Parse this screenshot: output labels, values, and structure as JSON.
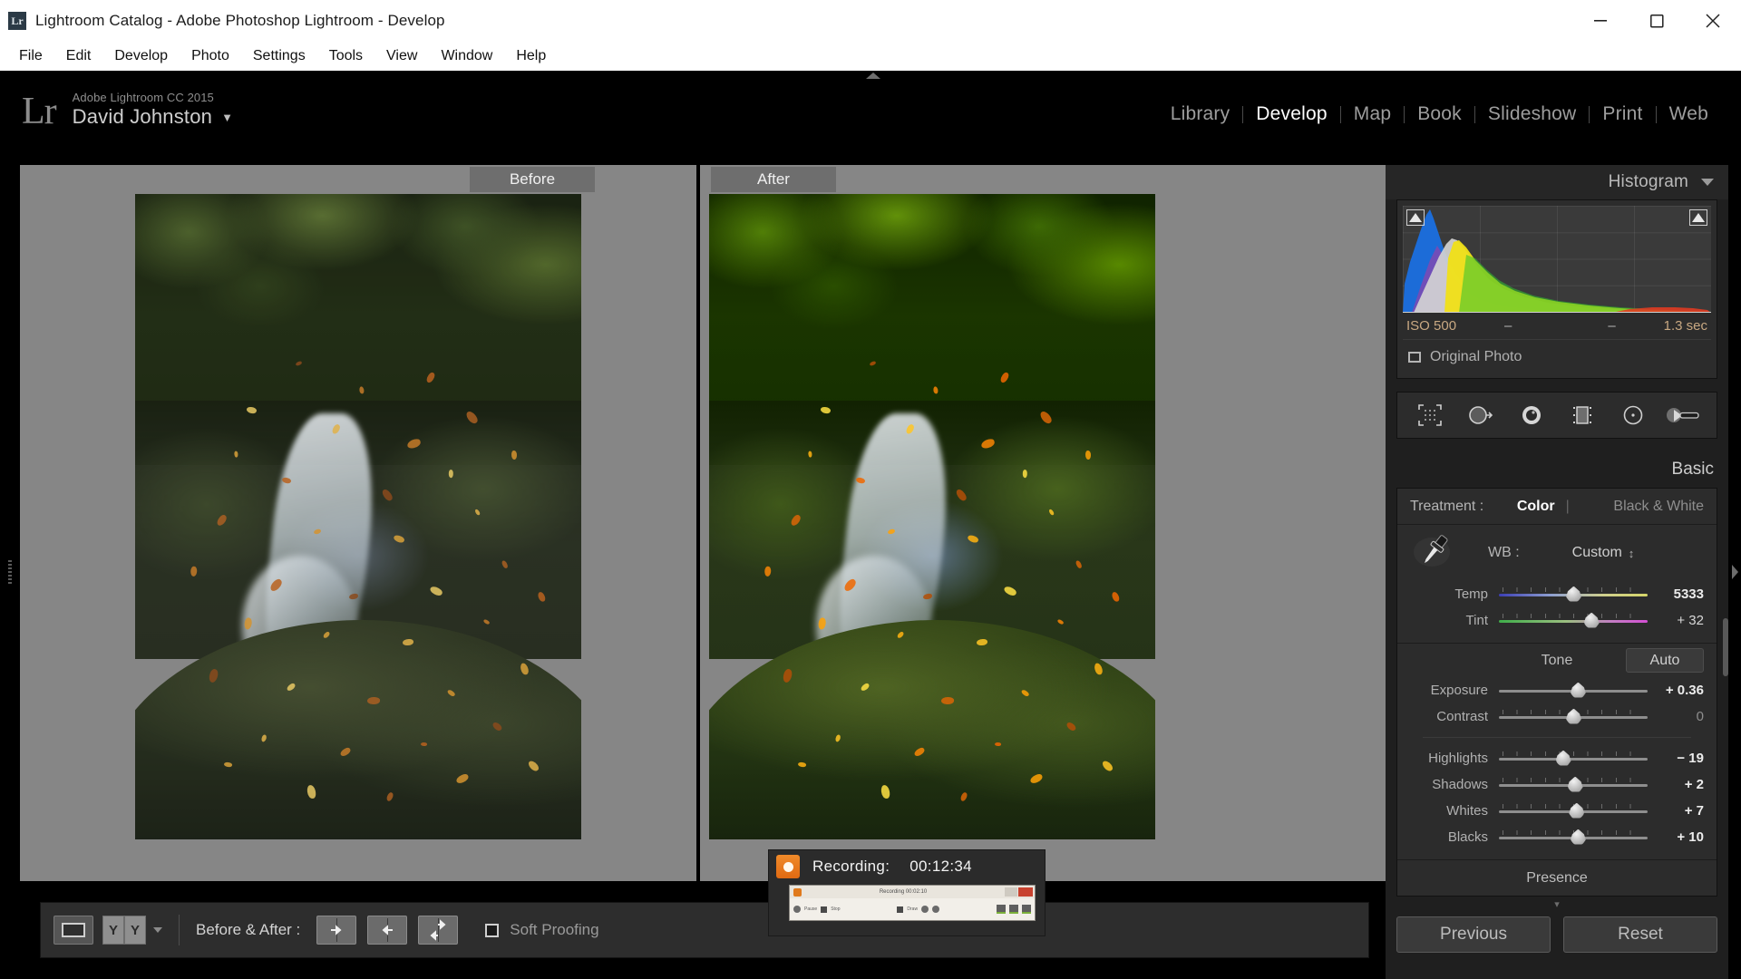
{
  "window": {
    "title": "Lightroom Catalog - Adobe Photoshop Lightroom - Develop",
    "app_badge": "Lr",
    "controls": {
      "minimize": "minimize-icon",
      "restore": "restore-icon",
      "close": "close-icon"
    }
  },
  "menubar": {
    "items": [
      "File",
      "Edit",
      "Develop",
      "Photo",
      "Settings",
      "Tools",
      "View",
      "Window",
      "Help"
    ]
  },
  "identity": {
    "logo": "Lr",
    "app_line": "Adobe Lightroom CC 2015",
    "user_name": "David Johnston",
    "caret": "▼"
  },
  "modules": {
    "items": [
      {
        "label": "Library",
        "active": false
      },
      {
        "label": "Develop",
        "active": true
      },
      {
        "label": "Map",
        "active": false
      },
      {
        "label": "Book",
        "active": false
      },
      {
        "label": "Slideshow",
        "active": false
      },
      {
        "label": "Print",
        "active": false
      },
      {
        "label": "Web",
        "active": false
      }
    ]
  },
  "view": {
    "before_label": "Before",
    "after_label": "After"
  },
  "toolbar": {
    "loupe_icon": "loupe-view-icon",
    "view_mode": {
      "left": "Y",
      "right": "Y"
    },
    "before_after_label": "Before & After :",
    "compare_modes": [
      "before-after-left-right-icon",
      "before-after-right-left-icon",
      "before-after-top-bottom-icon"
    ],
    "soft_proofing_label": "Soft Proofing",
    "soft_proofing_checked": false
  },
  "histogram": {
    "title": "Histogram",
    "iso": "ISO 500",
    "focal": "–",
    "aperture": "–",
    "shutter": "1.3 sec",
    "original_photo_label": "Original Photo",
    "original_photo_checked": false
  },
  "tools": {
    "items": [
      "crop-overlay-icon",
      "spot-removal-icon",
      "red-eye-icon",
      "graduated-filter-icon",
      "radial-filter-icon",
      "adjustment-brush-icon"
    ]
  },
  "basic": {
    "title": "Basic",
    "treatment_label": "Treatment :",
    "treatment_options": [
      "Color",
      "Black & White"
    ],
    "treatment_selected": "Color",
    "wb_label": "WB :",
    "wb_value": "Custom",
    "wb_stepper": "↕",
    "dropper_icon": "white-balance-dropper-icon",
    "wb_sliders": [
      {
        "name": "Temp",
        "value": "5333",
        "pos": 50,
        "type": "temp",
        "bold": true
      },
      {
        "name": "Tint",
        "value": "+ 32",
        "pos": 62,
        "type": "tint",
        "bold": false
      }
    ],
    "tone_label": "Tone",
    "auto_label": "Auto",
    "tone_sliders": [
      {
        "name": "Exposure",
        "value": "+ 0.36",
        "pos": 53,
        "ticks": false,
        "bold": true
      },
      {
        "name": "Contrast",
        "value": "0",
        "pos": 50,
        "ticks": true,
        "bold": false
      },
      {
        "name": "Highlights",
        "value": "− 19",
        "pos": 43,
        "ticks": true,
        "bold": true
      },
      {
        "name": "Shadows",
        "value": "+ 2",
        "pos": 51,
        "ticks": true,
        "bold": true
      },
      {
        "name": "Whites",
        "value": "+ 7",
        "pos": 52,
        "ticks": true,
        "bold": true
      },
      {
        "name": "Blacks",
        "value": "+ 10",
        "pos": 53,
        "ticks": true,
        "bold": true
      }
    ],
    "presence_label": "Presence"
  },
  "panel_buttons": {
    "previous": "Previous",
    "reset": "Reset"
  },
  "recording": {
    "label": "Recording:",
    "time": "00:12:34",
    "thumb_title": "Recording  00:02:10",
    "thumb_pause": "Pause",
    "thumb_stop": "Stop",
    "thumb_draw": "Draw"
  },
  "colors": {
    "accent_orange": "#e8800f",
    "panel_bg": "#1f1f1f",
    "canvas_gray": "#868686",
    "active_text": "#ffffff"
  }
}
